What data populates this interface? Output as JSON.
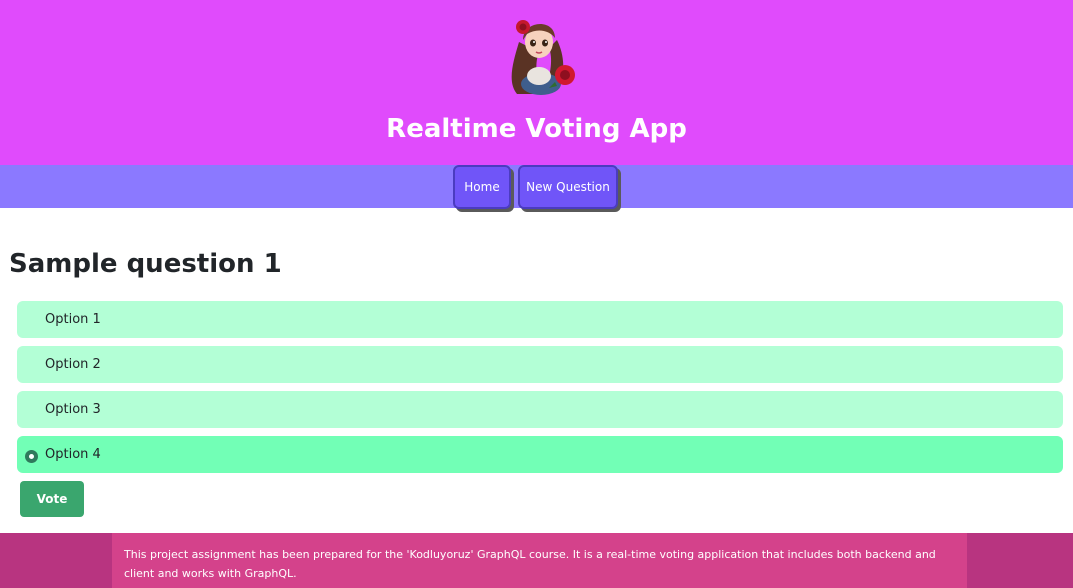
{
  "header": {
    "title": "Realtime Voting App",
    "avatar_icon": "girl-with-rose-avatar",
    "bg_color": "#e04bfc"
  },
  "nav": {
    "home_label": "Home",
    "new_question_label": "New Question",
    "bg_color": "#8b79ff",
    "button_color": "#7055f8"
  },
  "question": {
    "title": "Sample question 1",
    "options": [
      {
        "label": "Option 1",
        "selected": false
      },
      {
        "label": "Option 2",
        "selected": false
      },
      {
        "label": "Option 3",
        "selected": false
      },
      {
        "label": "Option 4",
        "selected": true
      }
    ],
    "vote_label": "Vote",
    "option_color": "#b3ffd6",
    "selected_option_color": "#72ffb6",
    "vote_color": "#3aa66e"
  },
  "footer": {
    "text": "This project assignment has been prepared for the 'Kodluyoruz' GraphQL course. It is a real-time voting application that includes both backend and client and works with GraphQL.",
    "bg_color": "#d4428b"
  }
}
